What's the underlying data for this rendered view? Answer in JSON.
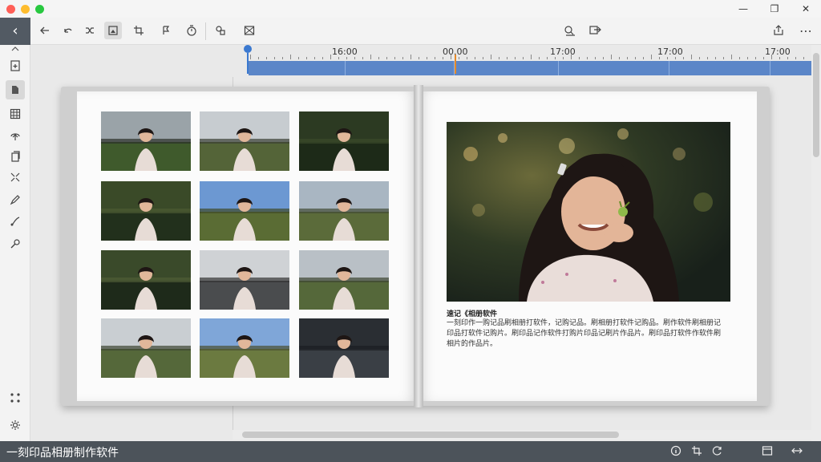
{
  "toolbar": {
    "back": "‹",
    "icons": [
      "arrow-left-icon",
      "undo-icon",
      "shuffle-icon",
      "page-layout-icon",
      "crop-icon",
      "text-icon",
      "timer-icon",
      "shapes-icon",
      "image-frame-icon"
    ],
    "right_icons": [
      "preview-icon",
      "export-icon"
    ],
    "share": "share-icon",
    "more": "⋯"
  },
  "window": {
    "minimize": "—",
    "restore": "❐",
    "close": "✕"
  },
  "rail": [
    "add-page-icon",
    "page-icon",
    "grid-icon",
    "upload-icon",
    "copy-icon",
    "transform-icon",
    "pen-icon",
    "path-icon",
    "tools-icon",
    "connect-icon",
    "settings-icon"
  ],
  "timeline": {
    "labels": [
      "16:00",
      "00.00",
      "17:00",
      "17:00",
      "17:00"
    ]
  },
  "book": {
    "right_page": {
      "caption_title": "速记《相册软件",
      "caption_body": "一刻印作一购记品刷相册打软件，记购记品。刷相册打软件记购品。刷作软件刷相册记印品打软件记购片。刷印品记作软件打购片印品记刷片作品片。刷印品打软件作软件刷相片的作品片。"
    }
  },
  "statusbar": {
    "app_name": "一刻印品相册制作软件",
    "icons": [
      "info-icon",
      "crop-icon",
      "refresh-icon",
      "grid-icon",
      "arrows-icon"
    ]
  },
  "colors": {
    "accent": "#5b86c8",
    "statusbar": "#4c535a",
    "marker": "#e58a2a"
  }
}
